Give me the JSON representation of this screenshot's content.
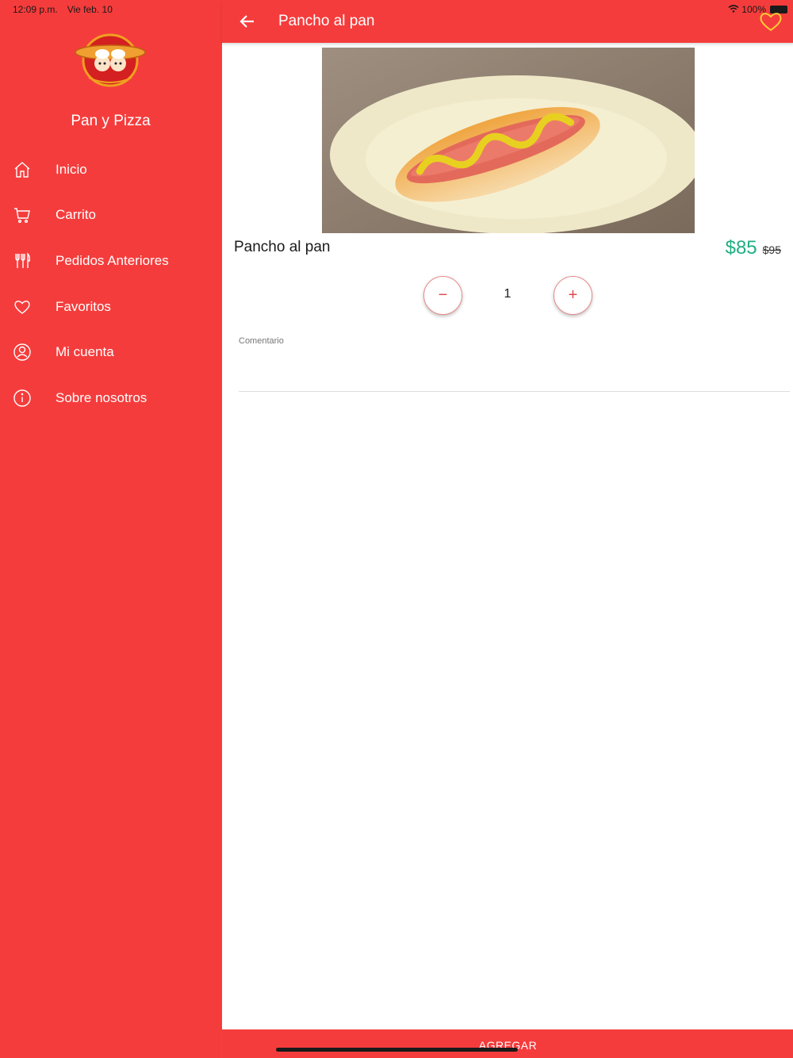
{
  "status_bar": {
    "time": "12:09 p.m.",
    "date": "Vie feb. 10",
    "battery": "100%"
  },
  "sidebar": {
    "brand": "Pan y Pizza",
    "logo_text": "Pan y Pizza",
    "items": [
      {
        "label": "Inicio",
        "icon": "home-icon"
      },
      {
        "label": "Carrito",
        "icon": "cart-icon"
      },
      {
        "label": "Pedidos Anteriores",
        "icon": "cutlery-icon"
      },
      {
        "label": "Favoritos",
        "icon": "heart-icon"
      },
      {
        "label": "Mi cuenta",
        "icon": "user-icon"
      },
      {
        "label": "Sobre nosotros",
        "icon": "info-icon"
      }
    ]
  },
  "appbar": {
    "title": "Pancho al pan",
    "back_icon": "arrow-left-icon",
    "favorite_icon": "heart-outline-icon"
  },
  "product": {
    "name": "Pancho al pan",
    "price": "$85",
    "old_price": "$95",
    "quantity": "1"
  },
  "comment": {
    "label": "Comentario",
    "value": ""
  },
  "footer": {
    "add_label": "AGREGAR"
  },
  "colors": {
    "primary": "#f53c3c",
    "price": "#1fae84",
    "favorite": "#ffcc33"
  }
}
